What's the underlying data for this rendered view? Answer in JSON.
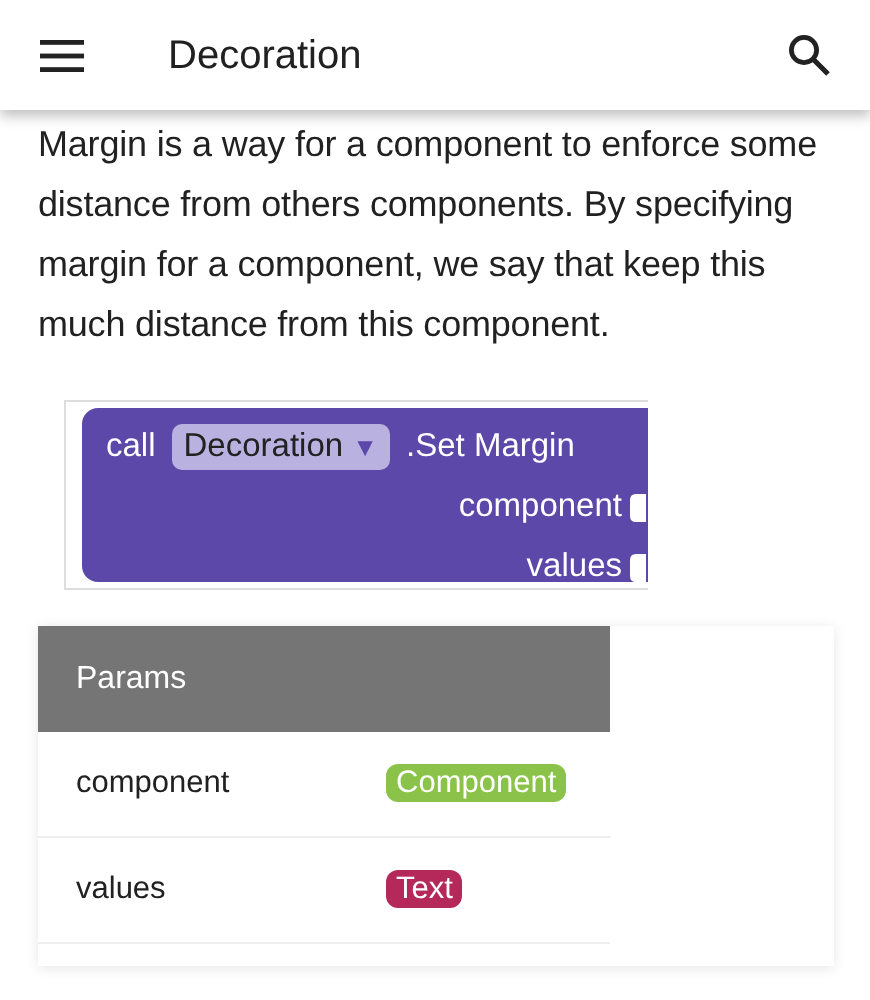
{
  "app_bar": {
    "title": "Decoration"
  },
  "description": "Margin is a way for a component to enforce some distance from others components. By specifying margin for a component, we say that keep this much distance from this component.",
  "block": {
    "keyword": "call",
    "component": "Decoration",
    "dropdown_arrow": "▼",
    "method": ".Set Margin",
    "sockets": [
      "component",
      "values"
    ]
  },
  "params_table": {
    "header": "Params",
    "rows": [
      {
        "name": "component",
        "type": "Component",
        "color": "#8bc34a"
      },
      {
        "name": "values",
        "type": "Text",
        "color": "#b5285a"
      }
    ]
  }
}
